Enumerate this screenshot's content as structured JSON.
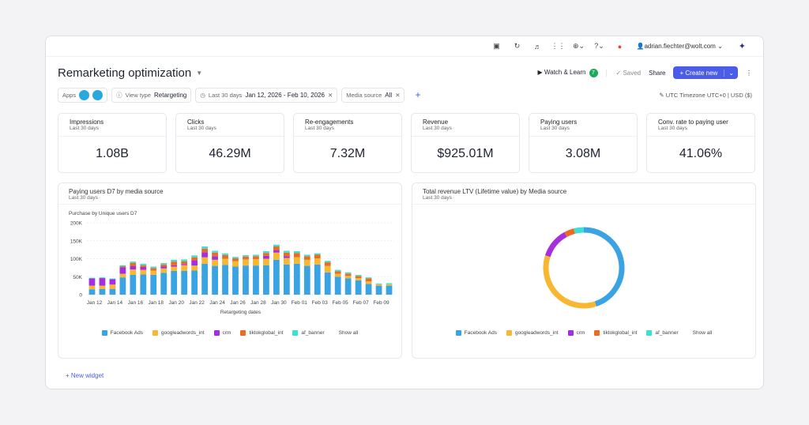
{
  "topbar": {
    "icons": [
      "chat-icon",
      "refresh-icon",
      "translate-icon",
      "grid-icon",
      "globe-icon",
      "help-icon",
      "notification-icon"
    ],
    "user": "adrian.fiechter@wolt.com"
  },
  "header": {
    "title": "Remarketing optimization",
    "watch_learn": "Watch & Learn",
    "watch_badge": "7",
    "saved": "Saved",
    "share": "Share",
    "create_new": "+ Create new"
  },
  "filters": {
    "apps_label": "Apps",
    "view_type_label": "View type",
    "view_type_value": "Retargeting",
    "date_label": "Last 30 days",
    "date_value": "Jan 12, 2026 - Feb 10, 2026",
    "media_label": "Media source",
    "media_value": "All",
    "timezone": "UTC Timezone UTC+0 | USD ($)"
  },
  "kpis": [
    {
      "title": "Impressions",
      "sub": "Last 30 days",
      "value": "1.08B"
    },
    {
      "title": "Clicks",
      "sub": "Last 30 days",
      "value": "46.29M"
    },
    {
      "title": "Re-engagements",
      "sub": "Last 30 days",
      "value": "7.32M"
    },
    {
      "title": "Revenue",
      "sub": "Last 30 days",
      "value": "$925.01M"
    },
    {
      "title": "Paying users",
      "sub": "Last 30 days",
      "value": "3.08M"
    },
    {
      "title": "Conv. rate to paying user",
      "sub": "Last 30 days",
      "value": "41.06%"
    }
  ],
  "legend": {
    "show_all": "Show all"
  },
  "new_widget": "+ New widget",
  "chart_data": [
    {
      "type": "bar",
      "stacked": true,
      "title": "Paying users D7 by media source",
      "subtitle": "Last 30 days",
      "ylabel": "Purchase by Unique users D7",
      "xlabel": "Retargeting dates",
      "ylim": [
        0,
        200000
      ],
      "yticks": [
        "0",
        "50K",
        "100K",
        "150K",
        "200K"
      ],
      "grid": true,
      "categories": [
        "Jan 12",
        "Jan 13",
        "Jan 14",
        "Jan 15",
        "Jan 16",
        "Jan 17",
        "Jan 18",
        "Jan 19",
        "Jan 20",
        "Jan 21",
        "Jan 22",
        "Jan 23",
        "Jan 24",
        "Jan 25",
        "Jan 26",
        "Jan 27",
        "Jan 28",
        "Jan 29",
        "Jan 30",
        "Jan 31",
        "Feb 01",
        "Feb 02",
        "Feb 03",
        "Feb 04",
        "Feb 05",
        "Feb 06",
        "Feb 07",
        "Feb 08",
        "Feb 09",
        "Feb 10"
      ],
      "xtick_labels": [
        "Jan 12",
        "Jan 14",
        "Jan 16",
        "Jan 18",
        "Jan 20",
        "Jan 22",
        "Jan 24",
        "Jan 26",
        "Jan 28",
        "Jan 30",
        "Feb 01",
        "Feb 03",
        "Feb 05",
        "Feb 07",
        "Feb 09"
      ],
      "series": [
        {
          "name": "Facebook Ads",
          "color": "#3aa3e3",
          "values": [
            15000,
            16000,
            16000,
            48000,
            55000,
            56000,
            55000,
            61000,
            66000,
            66000,
            67000,
            86000,
            80000,
            83000,
            78000,
            81000,
            81000,
            82000,
            97000,
            84000,
            86000,
            80000,
            84000,
            62000,
            50000,
            45000,
            40000,
            30000,
            25000,
            25000
          ]
        },
        {
          "name": "googleadwords_int",
          "color": "#f7b731",
          "values": [
            10000,
            9000,
            12000,
            10000,
            15000,
            13000,
            12000,
            12000,
            12000,
            16000,
            14000,
            18000,
            17000,
            17000,
            15000,
            17000,
            18000,
            18000,
            20000,
            18000,
            18000,
            17000,
            17000,
            18000,
            8000,
            7000,
            6000,
            7000,
            4000,
            4000
          ]
        },
        {
          "name": "crm",
          "color": "#a62ee0",
          "values": [
            20000,
            21000,
            15000,
            18000,
            10000,
            8000,
            0,
            5000,
            4000,
            3000,
            15000,
            14000,
            10000,
            0,
            0,
            0,
            0,
            8000,
            7000,
            5000,
            0,
            0,
            0,
            0,
            0,
            0,
            0,
            0,
            0,
            0
          ]
        },
        {
          "name": "tiktokglobal_int",
          "color": "#ec6b23",
          "values": [
            0,
            0,
            0,
            3000,
            8000,
            5000,
            7000,
            6000,
            10000,
            8000,
            8000,
            10000,
            10000,
            10000,
            8000,
            8000,
            8000,
            8000,
            10000,
            10000,
            12000,
            10000,
            10000,
            10000,
            7000,
            6000,
            6000,
            8000,
            0,
            0
          ]
        },
        {
          "name": "af_banner",
          "color": "#3de0d6",
          "values": [
            2000,
            2000,
            2000,
            3000,
            4000,
            4000,
            4000,
            4000,
            5000,
            5000,
            5000,
            6000,
            5000,
            5000,
            4000,
            4000,
            4000,
            5000,
            5000,
            5000,
            5000,
            4000,
            4000,
            4000,
            4000,
            4000,
            3000,
            3000,
            2000,
            3000
          ]
        }
      ]
    },
    {
      "type": "pie",
      "donut": true,
      "title": "Total revenue LTV (Lifetime value) by Media source",
      "subtitle": "Last 30 days",
      "categories": [
        "Facebook Ads",
        "googleadwords_int",
        "crm",
        "tiktokglobal_int",
        "af_banner"
      ],
      "values": [
        45,
        35,
        12,
        4,
        4
      ],
      "colors": [
        "#3aa3e3",
        "#f7b731",
        "#a62ee0",
        "#ec6b23",
        "#3de0d6"
      ]
    }
  ]
}
